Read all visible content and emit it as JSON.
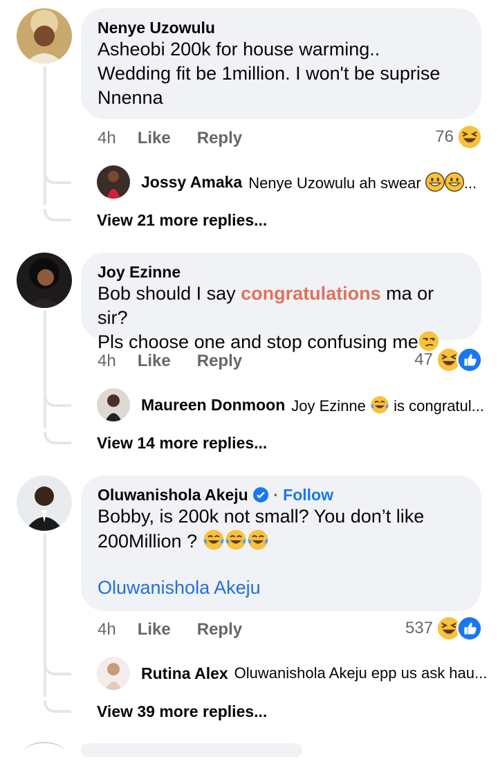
{
  "comments": [
    {
      "author": "Nenye Uzowulu",
      "text": "Asheobi 200k for house warming..\nWedding fit be 1million. I won't be suprise\nNnenna",
      "time": "4h",
      "like": "Like",
      "reply": "Reply",
      "reactions": "76",
      "reply_preview": {
        "author": "Jossy Amaka",
        "text": "Nenye Uzowulu ah swear"
      },
      "more_replies": "View 21 more replies..."
    },
    {
      "author": "Joy Ezinne",
      "text_before": "Bob should I say ",
      "text_highlight": "congratulations",
      "text_after": " ma or sir?\nPls choose one and stop confusing me",
      "time": "4h",
      "like": "Like",
      "reply": "Reply",
      "reactions": "47",
      "reply_preview": {
        "author": "Maureen Donmoon",
        "text_a": "Joy Ezinne",
        "text_b": "is congratul..."
      },
      "more_replies": "View 14 more replies..."
    },
    {
      "author": "Oluwanishola Akeju",
      "follow_sep": "·",
      "follow": "Follow",
      "text": "Bobby, is 200k not small? You don’t like\n200Million ?",
      "signature": "Oluwanishola Akeju",
      "time": "4h",
      "like": "Like",
      "reply": "Reply",
      "reactions": "537",
      "reply_preview": {
        "author": "Rutina Alex",
        "text": "Oluwanishola Akeju epp us ask hau..."
      },
      "more_replies": "View 39 more replies..."
    }
  ],
  "colors": {
    "bubble": "#f0f2f5",
    "link": "#216fdb",
    "highlight": "#e0715d",
    "muted": "#65676b"
  },
  "icons": [
    "laughing-emoji-icon",
    "like-reaction-icon",
    "grinning-emoji-icon",
    "tears-of-joy-emoji-icon",
    "unamused-emoji-icon",
    "verified-badge-icon"
  ]
}
